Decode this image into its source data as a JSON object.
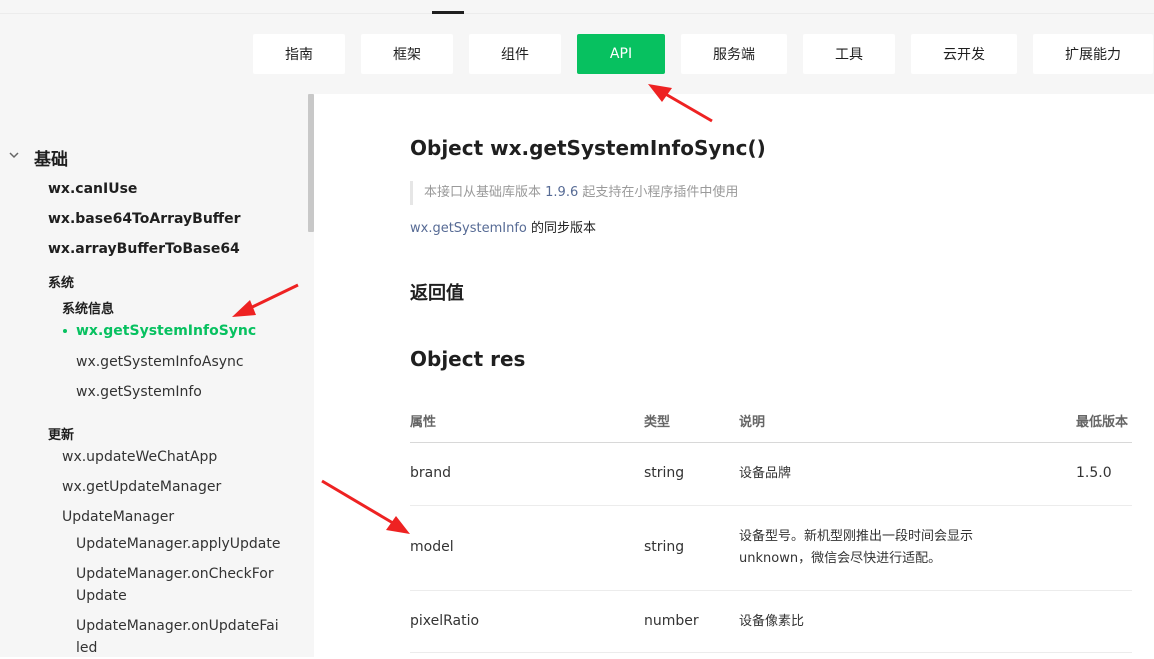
{
  "nav": {
    "items": [
      "指南",
      "框架",
      "组件",
      "API",
      "服务端",
      "工具",
      "云开发",
      "扩展能力"
    ],
    "active_index": 3,
    "accent_color": "#07c160"
  },
  "sidebar": {
    "group": "基础",
    "l1_items": [
      "wx.canIUse",
      "wx.base64ToArrayBuffer",
      "wx.arrayBufferToBase64"
    ],
    "system_category": "系统",
    "system_info_sub": "系统信息",
    "active_item": "wx.getSystemInfoSync",
    "system_items": [
      "wx.getSystemInfoAsync",
      "wx.getSystemInfo"
    ],
    "update_category": "更新",
    "update_items": [
      "wx.updateWeChatApp",
      "wx.getUpdateManager",
      "UpdateManager"
    ],
    "update_manager_items": [
      [
        "UpdateManager.applyUpdate"
      ],
      [
        "UpdateManager.onCheckFor",
        "Update"
      ],
      [
        "UpdateManager.onUpdateFai",
        "led"
      ]
    ]
  },
  "main": {
    "title": "Object wx.getSystemInfoSync()",
    "note_prefix": "本接口从基础库版本 ",
    "note_version": "1.9.6",
    "note_suffix": " 起支持在小程序插件中使用",
    "desc_link": "wx.getSystemInfo",
    "desc_text": " 的同步版本",
    "return_heading": "返回值",
    "res_heading": "Object res",
    "table": {
      "headers": [
        "属性",
        "类型",
        "说明",
        "最低版本"
      ],
      "rows": [
        {
          "prop": "brand",
          "type": "string",
          "desc": [
            "设备品牌"
          ],
          "min": "1.5.0"
        },
        {
          "prop": "model",
          "type": "string",
          "desc": [
            "设备型号。新机型刚推出一段时间会显示",
            "unknown，微信会尽快进行适配。"
          ],
          "min": ""
        },
        {
          "prop": "pixelRatio",
          "type": "number",
          "desc": [
            "设备像素比"
          ],
          "min": ""
        }
      ]
    }
  },
  "annotation_color": "#ee2222"
}
